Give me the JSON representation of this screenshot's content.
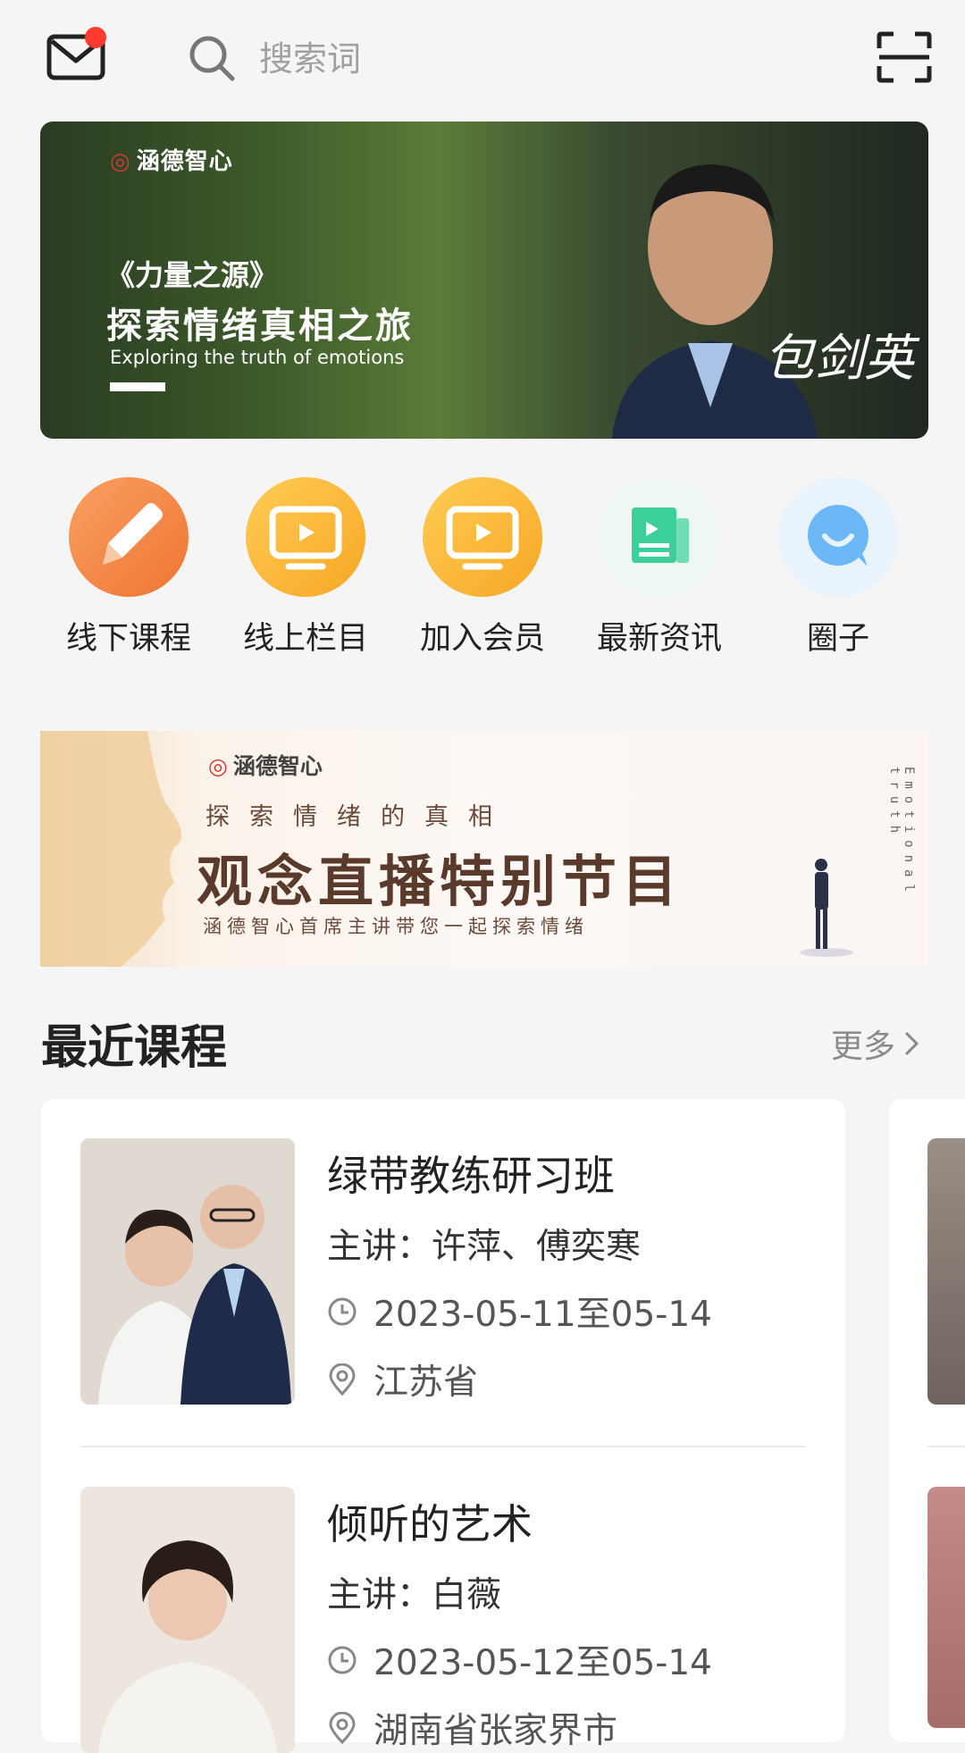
{
  "header": {
    "search_placeholder": "搜索词"
  },
  "banner_main": {
    "logo_text": "涵德智心",
    "subtitle": "《力量之源》",
    "title": "探索情绪真相之旅",
    "english": "Exploring the truth of emotions",
    "signature": "包剑英"
  },
  "quick_nav": [
    {
      "label": "线下课程",
      "icon": "pencil-icon",
      "color": "#f4874b"
    },
    {
      "label": "线上栏目",
      "icon": "tv-play-icon",
      "color": "#f9b23a"
    },
    {
      "label": "加入会员",
      "icon": "tv-play-icon",
      "color": "#f9b23a"
    },
    {
      "label": "最新资讯",
      "icon": "news-icon",
      "color": "#3ccf9a"
    },
    {
      "label": "圈子",
      "icon": "chat-bubble-icon",
      "color": "#5aaef5"
    }
  ],
  "banner_live": {
    "logo_text": "涵德智心",
    "kicker": "探索情绪的真相",
    "title": "观念直播特别节目",
    "description": "涵德智心首席主讲带您一起探索情绪",
    "side_text": "Emotional truth"
  },
  "section": {
    "title": "最近课程",
    "more": "更多"
  },
  "courses": [
    {
      "title": "绿带教练研习班",
      "lecturer": "主讲：许萍、傅奕寒",
      "date": "2023-05-11至05-14",
      "location": "江苏省"
    },
    {
      "title": "倾听的艺术",
      "lecturer": "主讲：白薇",
      "date": "2023-05-12至05-14",
      "location": "湖南省张家界市"
    }
  ],
  "colors": {
    "accent_red": "#ff3b30",
    "background": "#f5f5f5"
  }
}
